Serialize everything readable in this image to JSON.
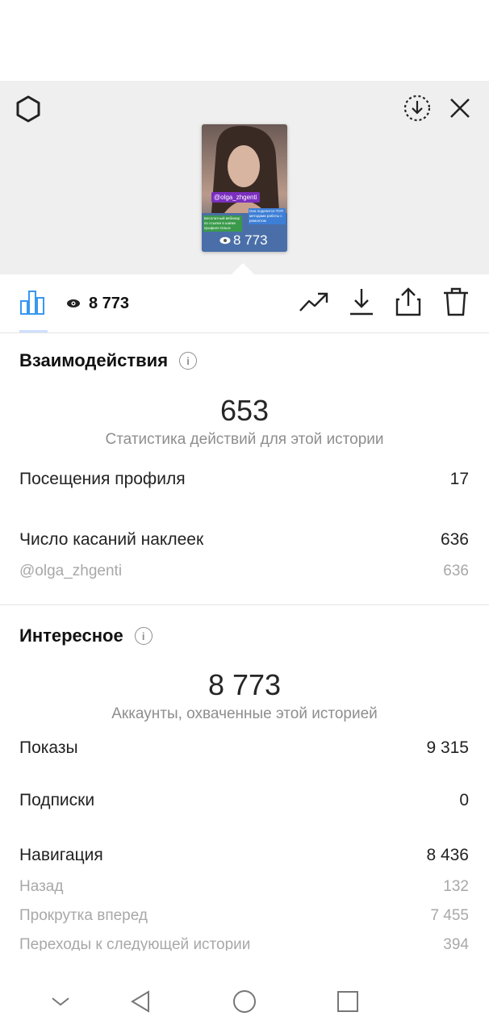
{
  "story": {
    "thumbnail_handle": "@olga_zhgenti",
    "thumbnail_views": "8 773",
    "thumbnail_sticker_left": "Бесплатный вебинар по ссылке в шапке профиля Ольги",
    "thumbnail_sticker_right": "Она поделится ТОП методами работы с ремонтом"
  },
  "toolbar": {
    "views_count": "8 773"
  },
  "interactions": {
    "title": "Взаимодействия",
    "total": "653",
    "caption": "Статистика действий для этой истории",
    "rows": [
      {
        "label": "Посещения профиля",
        "value": "17"
      },
      {
        "label": "Число касаний наклеек",
        "value": "636"
      }
    ],
    "sub_rows": [
      {
        "label": "@olga_zhgenti",
        "value": "636"
      }
    ]
  },
  "discovery": {
    "title": "Интересное",
    "total": "8 773",
    "caption": "Аккаунты, охваченные этой историей",
    "rows": [
      {
        "label": "Показы",
        "value": "9 315"
      },
      {
        "label": "Подписки",
        "value": "0"
      },
      {
        "label": "Навигация",
        "value": "8 436"
      }
    ],
    "sub_rows": [
      {
        "label": "Назад",
        "value": "132"
      },
      {
        "label": "Прокрутка вперед",
        "value": "7 455"
      },
      {
        "label": "Переходы к следующей истории",
        "value": "394"
      }
    ]
  },
  "icons": {
    "settings": "gear-icon",
    "download_circle": "download-circle-icon",
    "close": "close-icon",
    "insights": "bar-chart-icon",
    "eye": "eye-icon",
    "trend": "trend-icon",
    "download": "download-icon",
    "share": "share-icon",
    "delete": "trash-icon"
  },
  "colors": {
    "accent": "#3897f0",
    "muted": "#8e8e8e",
    "subtle": "#a8a8a8"
  }
}
